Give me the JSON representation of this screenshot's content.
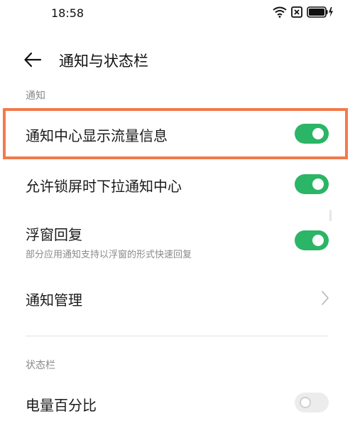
{
  "status_bar": {
    "time": "18:58",
    "icons": [
      "wifi-icon",
      "sim-blocked-icon",
      "battery-charging-icon"
    ]
  },
  "header": {
    "title": "通知与状态栏",
    "back_icon": "arrow-left-icon"
  },
  "sections": [
    {
      "label": "通知",
      "items": [
        {
          "title": "通知中心显示流量信息",
          "type": "toggle",
          "state": "on",
          "highlighted": true
        },
        {
          "title": "允许锁屏时下拉通知中心",
          "type": "toggle",
          "state": "on"
        },
        {
          "title": "浮窗回复",
          "subtitle": "部分应用通知支持以浮窗的形式快速回复",
          "type": "toggle",
          "state": "on"
        },
        {
          "title": "通知管理",
          "type": "link",
          "icon": "chevron-right-icon"
        }
      ]
    },
    {
      "label": "状态栏",
      "items": [
        {
          "title": "电量百分比",
          "type": "toggle",
          "state": "off"
        }
      ]
    }
  ],
  "colors": {
    "toggle_on": "#2bb566",
    "toggle_off": "#ececec",
    "highlight": "#f27a4c",
    "section_label": "#8a8a8a"
  }
}
